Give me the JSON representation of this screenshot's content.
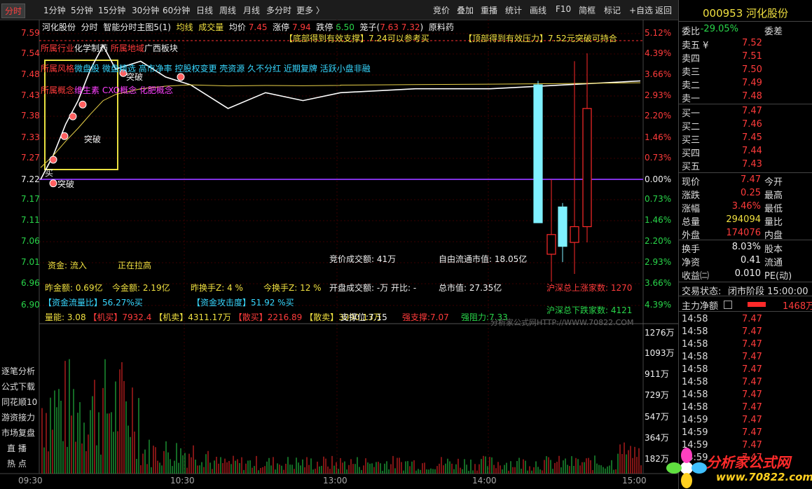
{
  "toolbar": {
    "left_tabs": [
      "分时",
      "1分钟",
      "5分钟",
      "15分钟",
      "30分钟",
      "60分钟",
      "日线",
      "周线",
      "月线",
      "多分时",
      "更多 〉"
    ],
    "right_tabs": [
      "竞价",
      "叠加",
      "重播",
      "统计",
      "画线",
      "F10",
      "简框",
      "标记",
      "+自选",
      "返回"
    ]
  },
  "header": {
    "stock_name": "河化股份",
    "mode": "分时",
    "indicator": "智能分时主图5(1)",
    "avg_line_label": "均线",
    "volume_label": "成交量",
    "avg_price_label": "均价",
    "avg_price": "7.45",
    "limit_up_label": "涨停",
    "limit_up": "7.94",
    "limit_down_label": "跌停",
    "limit_down": "6.50",
    "chips_label": "笼子",
    "chips_open": "(",
    "chips": "7.63 7.32",
    "chips_close": ")",
    "sector_tag": "原料药"
  },
  "annotations": {
    "support_note": "【底部得到有效支撑】7.24可以参考买",
    "pressure_note": "【顶部得到有效压力】7.52元突破可持合",
    "industry": "所属行业",
    "industry_value": "化学制药",
    "region": "所属地域",
    "region_value": "广西板块",
    "style": "所属风格",
    "style_value": "微盘股 微盘精选 高市净率 控股权变更 壳资源 久不分红 近期复牌 活跃小盘非融",
    "concept": "所属概念",
    "concept_value": "维生素 CXO概念 化肥概念",
    "breakout": "突破",
    "buy_mark": "买"
  },
  "y_axis_prices": [
    "7.59",
    "7.54",
    "7.48",
    "7.43",
    "7.38",
    "7.33",
    "7.27",
    "7.22",
    "7.17",
    "7.11",
    "7.06",
    "7.01",
    "6.96",
    "6.90"
  ],
  "y_axis_pcts": [
    "5.12%",
    "4.39%",
    "3.66%",
    "2.93%",
    "2.20%",
    "1.46%",
    "0.73%",
    "0.00%",
    "0.73%",
    "1.46%",
    "2.20%",
    "2.93%",
    "3.66%",
    "4.39%"
  ],
  "vol_axis": [
    "1276万",
    "1093万",
    "911万",
    "729万",
    "547万",
    "364万",
    "182万"
  ],
  "x_axis": [
    "09:30",
    "10:30",
    "13:00",
    "14:00",
    "15:00"
  ],
  "stats": {
    "fund_label": "资金:",
    "fund_value": "流入",
    "rising": "正在拉高",
    "auction_amount": "竞价成交额: 41万",
    "float_cap": "自由流通市值: 18.05亿",
    "prev_amount": "昨金额: 0.69亿",
    "today_amount": "今金额: 2.19亿",
    "prev_turnover": "昨换手Z:  4  %",
    "today_turnover": "今换手Z:  12  %",
    "open_amount": "开盘成交额: -万 开比: -",
    "market_cap": "总市值: 27.35亿",
    "up_count_label": "沪深总上涨家数:",
    "up_count": "1270",
    "inflow_ratio": "【资金流量比】56.27%买",
    "attack": "【资金攻击度】51.92 %买",
    "down_count_label": "沪深总下跌家数:",
    "down_count": "4121",
    "vol_ratio": "量能: 3.08",
    "inst_buy": "【机买】7932.4",
    "inst_sell": "【机卖】4311.17万",
    "retail_buy": "【散买】2216.89",
    "retail_sell": "【散卖】3090.13万",
    "support": "支撑位:7.15",
    "strong_support": "强支撑:7.07",
    "strong_resist": "强阻力:7.33",
    "watermark": "分析家公式网HTTP://WWW.70822.COM"
  },
  "side_menu": [
    "逐笔分析",
    "公式下载",
    "同花顺10",
    "游资接力",
    "市场复盘",
    "直  播",
    "热  点"
  ],
  "right_panel": {
    "code": "000953",
    "name": "河化股份",
    "wei_bi_label": "委比",
    "wei_bi": "-29.05%",
    "wei_cha_label": "委差",
    "sell": [
      {
        "label": "卖五 ¥",
        "price": "7.52"
      },
      {
        "label": "卖四",
        "price": "7.51"
      },
      {
        "label": "卖三",
        "price": "7.50"
      },
      {
        "label": "卖二",
        "price": "7.49"
      },
      {
        "label": "卖一",
        "price": "7.48"
      }
    ],
    "buy": [
      {
        "label": "买一",
        "price": "7.47"
      },
      {
        "label": "买二",
        "price": "7.46"
      },
      {
        "label": "买三",
        "price": "7.45"
      },
      {
        "label": "买四",
        "price": "7.44"
      },
      {
        "label": "买五",
        "price": "7.43"
      }
    ],
    "quote": [
      {
        "l1": "现价",
        "v1": "7.47",
        "l2": "今开",
        "c": "red"
      },
      {
        "l1": "涨跌",
        "v1": "0.25",
        "l2": "最高",
        "c": "red"
      },
      {
        "l1": "涨幅",
        "v1": "3.46%",
        "l2": "最低",
        "c": "red"
      },
      {
        "l1": "总量",
        "v1": "294094",
        "l2": "量比",
        "c": "yellow"
      },
      {
        "l1": "外盘",
        "v1": "174076",
        "l2": "内盘",
        "c": "red"
      }
    ],
    "quote2": [
      {
        "l1": "换手",
        "v1": "8.03%",
        "l2": "股本"
      },
      {
        "l1": "净资",
        "v1": "0.41",
        "l2": "流通"
      },
      {
        "l1": "收益㈡",
        "v1": "0.010",
        "l2": "PE(动)"
      }
    ],
    "trade_status_label": "交易状态:",
    "trade_status": "闭市阶段 15:00:00",
    "net_flow_label": "主力净额",
    "net_flow": "1468万",
    "ticks": [
      {
        "t": "14:58",
        "p": "7.47"
      },
      {
        "t": "14:58",
        "p": "7.47"
      },
      {
        "t": "14:58",
        "p": "7.47"
      },
      {
        "t": "14:58",
        "p": "7.47"
      },
      {
        "t": "14:58",
        "p": "7.47"
      },
      {
        "t": "14:58",
        "p": "7.47"
      },
      {
        "t": "14:58",
        "p": "7.47"
      },
      {
        "t": "14:58",
        "p": "7.47"
      },
      {
        "t": "14:59",
        "p": "7.47"
      },
      {
        "t": "14:59",
        "p": "7.47"
      },
      {
        "t": "14:59",
        "p": "7.47"
      },
      {
        "t": "14:59",
        "p": "7.47"
      }
    ]
  },
  "logo": {
    "title": "分析家公式网",
    "url": "www.70822.com"
  },
  "colors": {
    "up": "#ff3b3b",
    "down": "#29d64a",
    "price_line": "#ffffff",
    "avg_line": "#e8d048",
    "zero_line": "#8030e0",
    "kcyan": "#7ff0ff",
    "kred": "#ff2a2a"
  },
  "chart_data": {
    "type": "line",
    "x": [
      "09:30",
      "09:35",
      "09:40",
      "09:45",
      "09:50",
      "09:55",
      "10:00",
      "10:10",
      "10:20",
      "10:30",
      "10:45",
      "11:00",
      "11:15",
      "11:30",
      "13:00",
      "13:30",
      "14:00",
      "14:30",
      "15:00"
    ],
    "series": [
      {
        "values": [
          7.22,
          7.28,
          7.36,
          7.42,
          7.5,
          7.56,
          7.5,
          7.52,
          7.48,
          7.46,
          7.4,
          7.44,
          7.42,
          7.44,
          7.44,
          7.45,
          7.45,
          7.46,
          7.47
        ]
      }
    ],
    "ylim": [
      6.9,
      7.59
    ],
    "klines": [
      {
        "open": 7.46,
        "close": 7.11,
        "high": 7.47,
        "low": 7.11,
        "color": "cyan"
      },
      {
        "open": 7.08,
        "close": 7.03,
        "high": 7.22,
        "low": 6.96,
        "color": "red"
      },
      {
        "open": 7.05,
        "close": 7.15,
        "high": 7.16,
        "low": 7.01,
        "color": "cyan"
      },
      {
        "open": 7.06,
        "close": 7.1,
        "high": 7.52,
        "low": 6.98,
        "color": "red"
      },
      {
        "open": 7.1,
        "close": 7.4,
        "high": 7.54,
        "low": 7.06,
        "color": "red"
      }
    ]
  }
}
